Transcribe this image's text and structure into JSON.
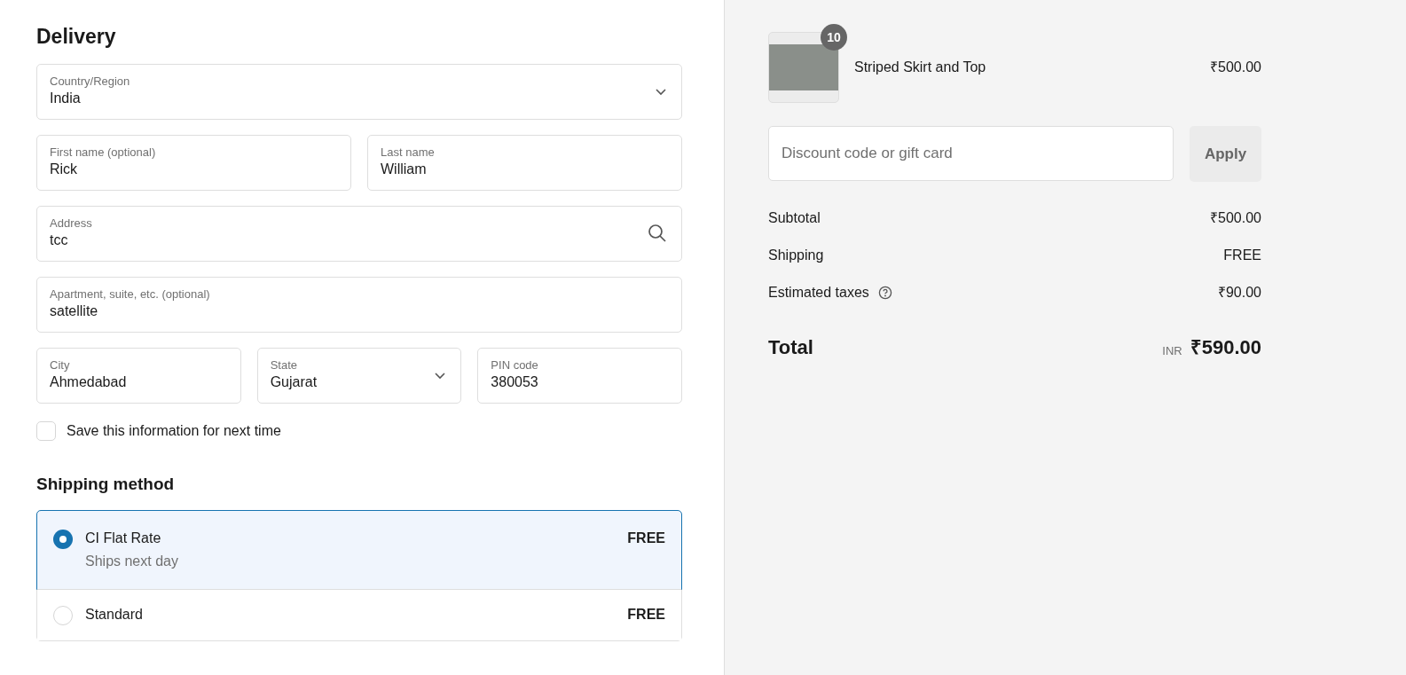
{
  "delivery": {
    "title": "Delivery",
    "rows": [
      [
        {
          "label": "Country/Region",
          "value": "India",
          "kind": "select"
        }
      ],
      [
        {
          "label": "First name (optional)",
          "value": "Rick",
          "kind": "text"
        },
        {
          "label": "Last name",
          "value": "William",
          "kind": "text"
        }
      ],
      [
        {
          "label": "Address",
          "value": "tcc",
          "kind": "search"
        }
      ],
      [
        {
          "label": "Apartment, suite, etc. (optional)",
          "value": "satellite",
          "kind": "text"
        }
      ],
      [
        {
          "label": "City",
          "value": "Ahmedabad",
          "kind": "text"
        },
        {
          "label": "State",
          "value": "Gujarat",
          "kind": "select"
        },
        {
          "label": "PIN code",
          "value": "380053",
          "kind": "text"
        }
      ]
    ],
    "save_info": {
      "label": "Save this information for next time",
      "checked": false
    }
  },
  "shipping": {
    "title": "Shipping method",
    "methods": [
      {
        "name": "CI Flat Rate",
        "note": "Ships next day",
        "price": "FREE",
        "selected": true
      },
      {
        "name": "Standard",
        "price": "FREE",
        "selected": false
      }
    ]
  },
  "order": {
    "item": {
      "name": "Striped Skirt and Top",
      "price": "₹500.00",
      "quantity": "10"
    },
    "discount": {
      "placeholder": "Discount code or gift card",
      "button": "Apply"
    },
    "lines": [
      {
        "label": "Subtotal",
        "value": "₹500.00",
        "kind": "plain"
      },
      {
        "label": "Shipping",
        "value": "FREE",
        "kind": "plain"
      },
      {
        "label": "Estimated taxes",
        "value": "₹90.00",
        "kind": "help"
      }
    ],
    "total": {
      "label": "Total",
      "currency": "INR",
      "value": "₹590.00"
    }
  }
}
